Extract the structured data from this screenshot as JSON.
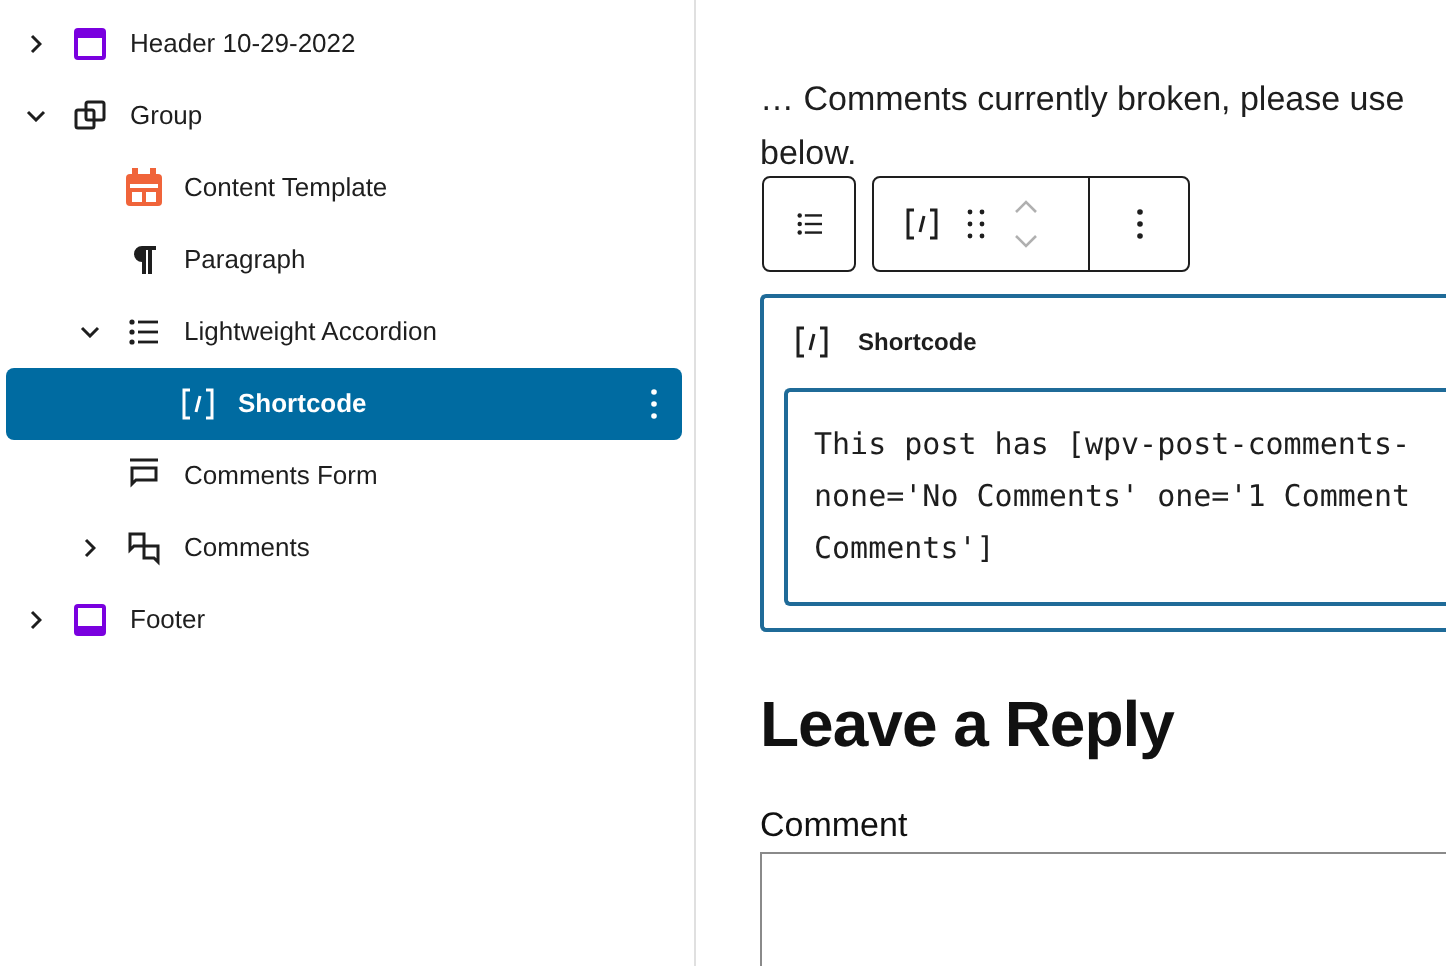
{
  "list_view": {
    "items": [
      {
        "label": "Header 10-29-2022",
        "kind": "template-part",
        "expanded": false,
        "selected": false
      },
      {
        "label": "Group",
        "kind": "group",
        "expanded": true,
        "selected": false,
        "children": [
          {
            "label": "Content Template",
            "kind": "content-template",
            "selected": false
          },
          {
            "label": "Paragraph",
            "kind": "paragraph",
            "selected": false
          },
          {
            "label": "Lightweight Accordion",
            "kind": "list",
            "expanded": true,
            "selected": false,
            "children": [
              {
                "label": "Shortcode",
                "kind": "shortcode",
                "selected": true
              }
            ]
          },
          {
            "label": "Comments Form",
            "kind": "comments-form",
            "selected": false
          },
          {
            "label": "Comments",
            "kind": "comments",
            "expanded": false,
            "selected": false
          }
        ]
      },
      {
        "label": "Footer",
        "kind": "footer",
        "expanded": false,
        "selected": false
      }
    ]
  },
  "editor": {
    "paragraph_lines": [
      "… Comments currently broken, please use",
      "below."
    ],
    "shortcode_block": {
      "label": "Shortcode",
      "lines": [
        "This post has [wpv-post-comments-",
        "none='No Comments' one='1 Comment",
        "Comments']"
      ]
    },
    "reply_heading": "Leave a Reply",
    "comment_label": "Comment"
  }
}
